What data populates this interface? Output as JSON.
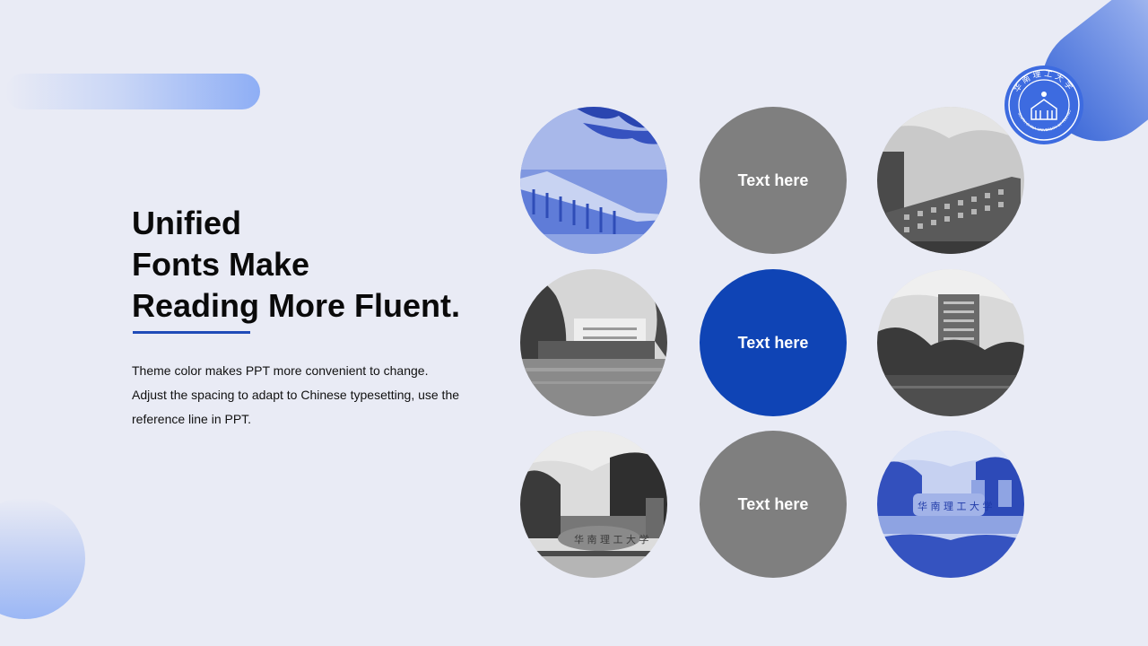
{
  "slide": {
    "title_lines": [
      "Unified",
      "Fonts Make",
      "Reading More Fluent."
    ],
    "body_lines": [
      "Theme color makes PPT more convenient to change.",
      "Adjust the spacing to adapt to Chinese typesetting, use the",
      "reference line in PPT."
    ]
  },
  "grid": {
    "text_circles": [
      {
        "label": "Text here",
        "color": "#7f7f7f"
      },
      {
        "label": "Text here",
        "color": "#0f44b5"
      },
      {
        "label": "Text here",
        "color": "#7f7f7f"
      }
    ],
    "photos": [
      "building-blue-photo",
      "apartment-gray-photo",
      "lake-gray-photo",
      "tower-lake-gray-photo",
      "gate-stone-gray-photo",
      "gate-stone-blue-photo"
    ]
  },
  "logo": {
    "text": "华南理工大学",
    "sub_text": "SOUTH CHINA UNIVERSITY OF TECHNOLOGY"
  },
  "colors": {
    "background": "#e9ebf5",
    "accent": "#0f44b5",
    "gray": "#7f7f7f"
  }
}
